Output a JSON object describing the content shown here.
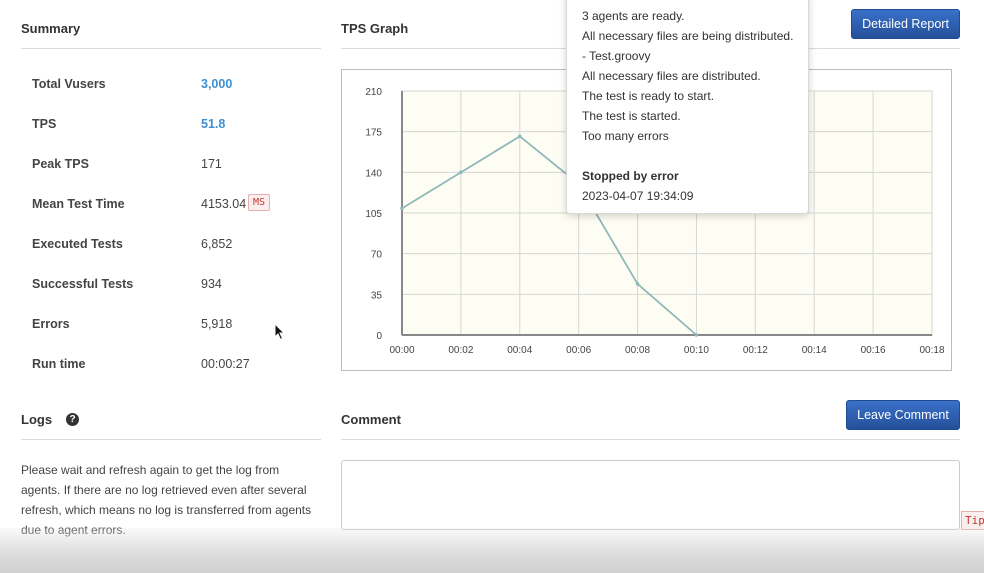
{
  "summary": {
    "title": "Summary",
    "rows": [
      {
        "label": "Total Vusers",
        "value": "3,000",
        "link": true
      },
      {
        "label": "TPS",
        "value": "51.8",
        "link": true
      },
      {
        "label": "Peak TPS",
        "value": "171",
        "link": false
      },
      {
        "label": "Mean Test Time",
        "value": "4153.04",
        "link": false,
        "unit": "MS"
      },
      {
        "label": "Executed Tests",
        "value": "6,852",
        "link": false
      },
      {
        "label": "Successful Tests",
        "value": "934",
        "link": false
      },
      {
        "label": "Errors",
        "value": "5,918",
        "link": false
      },
      {
        "label": "Run time",
        "value": "00:00:27",
        "link": false
      }
    ]
  },
  "tps_graph": {
    "title": "TPS Graph",
    "detailed_report_label": "Detailed Report"
  },
  "tooltip": {
    "lines": [
      "3 agents are ready.",
      "All necessary files are being distributed.",
      "- Test.groovy",
      "All necessary files are distributed.",
      "The test is ready to start.",
      "The test is started.",
      "Too many errors"
    ],
    "status": "Stopped by error",
    "timestamp": "2023-04-07 19:34:09"
  },
  "logs": {
    "title": "Logs",
    "help_icon": "question-circle-icon",
    "message": "Please wait and refresh again to get the log from agents. If there are no log retrieved even after several refresh, which means no log is transferred from agents due to agent errors."
  },
  "comment": {
    "title": "Comment",
    "button_label": "Leave Comment",
    "placeholder": "",
    "tip_label": "Tip"
  },
  "colors": {
    "accent": "#2c5fb5",
    "link": "#3d8fd1",
    "plot_bg": "#fdfdf3",
    "series": "#8fb8b8"
  },
  "chart_data": {
    "type": "line",
    "title": "",
    "xlabel": "",
    "ylabel": "",
    "x_ticks": [
      "00:00",
      "00:02",
      "00:04",
      "00:06",
      "00:08",
      "00:10",
      "00:12",
      "00:14",
      "00:16",
      "00:18"
    ],
    "y_ticks": [
      0,
      35,
      70,
      105,
      140,
      175,
      210
    ],
    "xlim_seconds": [
      0,
      18
    ],
    "ylim": [
      0,
      210
    ],
    "grid": true,
    "series": [
      {
        "name": "",
        "x_seconds": [
          0,
          2,
          4,
          6,
          8,
          10
        ],
        "values": [
          109,
          140,
          171,
          130,
          44,
          0
        ]
      }
    ]
  }
}
